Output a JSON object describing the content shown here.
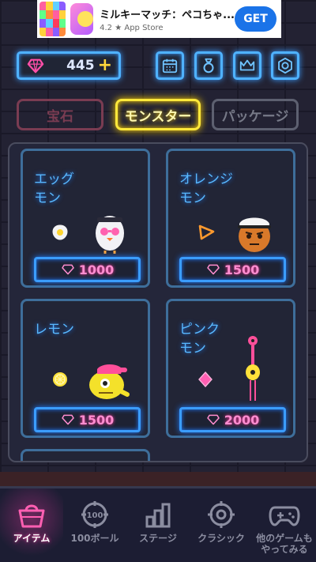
{
  "ad": {
    "title": "ミルキーマッチ：ペコちゃ...",
    "rating": "4.2 ★ App Store",
    "get_label": "GET"
  },
  "top": {
    "gem_count": "445",
    "plus": "+"
  },
  "tabs": [
    {
      "label": "宝石",
      "active": false
    },
    {
      "label": "モンスター",
      "active": true
    },
    {
      "label": "パッケージ",
      "active": false
    }
  ],
  "cards": [
    {
      "name_line1": "エッグ",
      "name_line2": "モン",
      "price": "1000"
    },
    {
      "name_line1": "オレンジ",
      "name_line2": "モン",
      "price": "1500"
    },
    {
      "name_line1": "レモン",
      "name_line2": "",
      "price": "1500"
    },
    {
      "name_line1": "ピンク",
      "name_line2": "モン",
      "price": "2000"
    }
  ],
  "nav": [
    {
      "label": "アイテム",
      "active": true
    },
    {
      "label": "100ボール",
      "active": false
    },
    {
      "label": "ステージ",
      "active": false
    },
    {
      "label": "クラシック",
      "active": false
    },
    {
      "label1": "他のゲームも",
      "label2": "やってみる",
      "active": false
    }
  ],
  "colors": {
    "neon_blue": "#4fb2ff",
    "neon_yellow": "#ffe93b",
    "neon_pink": "#ff4fa8"
  }
}
